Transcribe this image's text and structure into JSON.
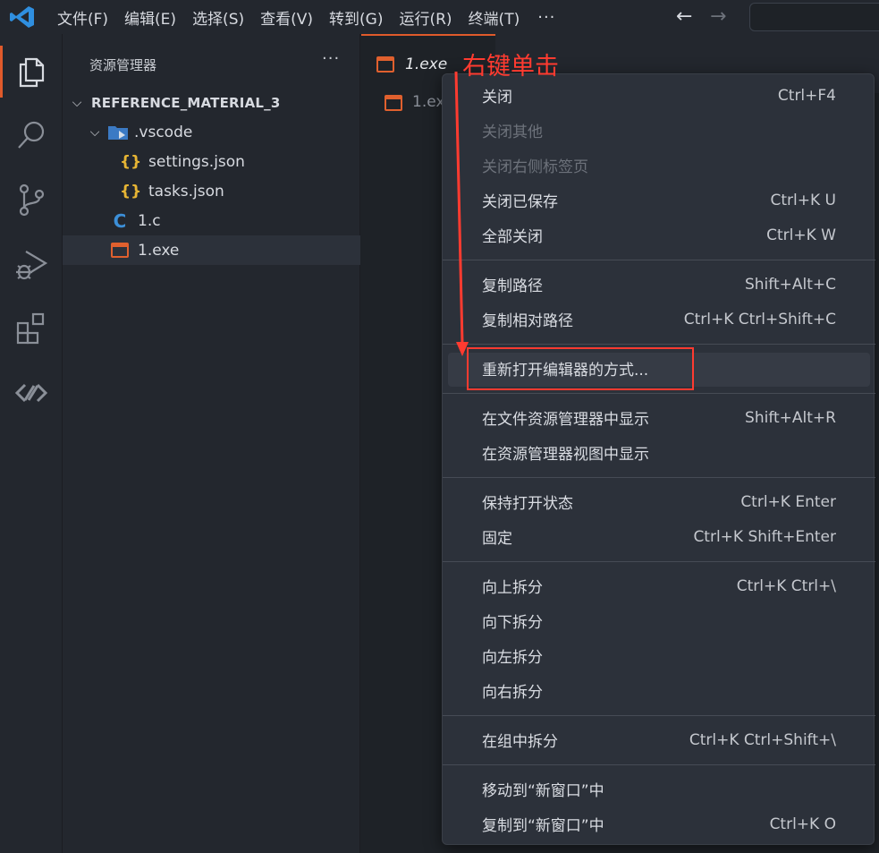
{
  "titlebar": {
    "menu": [
      "文件(F)",
      "编辑(E)",
      "选择(S)",
      "查看(V)",
      "转到(G)",
      "运行(R)",
      "终端(T)"
    ],
    "more": "···",
    "back": "←",
    "forward": "→"
  },
  "sidebar": {
    "title": "资源管理器",
    "dots": "···",
    "root": "REFERENCE_MATERIAL_3",
    "items": [
      {
        "label": ".vscode"
      },
      {
        "label": "settings.json"
      },
      {
        "label": "tasks.json"
      },
      {
        "label": "1.c"
      },
      {
        "label": "1.exe"
      }
    ]
  },
  "editor": {
    "tab_label": "1.exe",
    "breadcrumb": "1.ex"
  },
  "annotation": {
    "text": "右键单击"
  },
  "context_menu": {
    "items": [
      {
        "label": "关闭",
        "shortcut": "Ctrl+F4"
      },
      {
        "label": "关闭其他",
        "shortcut": ""
      },
      {
        "label": "关闭右侧标签页",
        "shortcut": ""
      },
      {
        "label": "关闭已保存",
        "shortcut": "Ctrl+K U"
      },
      {
        "label": "全部关闭",
        "shortcut": "Ctrl+K W"
      },
      {
        "label": "复制路径",
        "shortcut": "Shift+Alt+C"
      },
      {
        "label": "复制相对路径",
        "shortcut": "Ctrl+K Ctrl+Shift+C"
      },
      {
        "label": "重新打开编辑器的方式...",
        "shortcut": ""
      },
      {
        "label": "在文件资源管理器中显示",
        "shortcut": "Shift+Alt+R"
      },
      {
        "label": "在资源管理器视图中显示",
        "shortcut": ""
      },
      {
        "label": "保持打开状态",
        "shortcut": "Ctrl+K Enter"
      },
      {
        "label": "固定",
        "shortcut": "Ctrl+K Shift+Enter"
      },
      {
        "label": "向上拆分",
        "shortcut": "Ctrl+K Ctrl+\\"
      },
      {
        "label": "向下拆分",
        "shortcut": ""
      },
      {
        "label": "向左拆分",
        "shortcut": ""
      },
      {
        "label": "向右拆分",
        "shortcut": ""
      },
      {
        "label": "在组中拆分",
        "shortcut": "Ctrl+K Ctrl+Shift+\\"
      },
      {
        "label": "移动到“新窗口”中",
        "shortcut": ""
      },
      {
        "label": "复制到“新窗口”中",
        "shortcut": "Ctrl+K O"
      }
    ]
  },
  "colors": {
    "accent": "#e05a2b",
    "annotation": "#ff3b30",
    "vscode_blue": "#2f8fe0"
  }
}
